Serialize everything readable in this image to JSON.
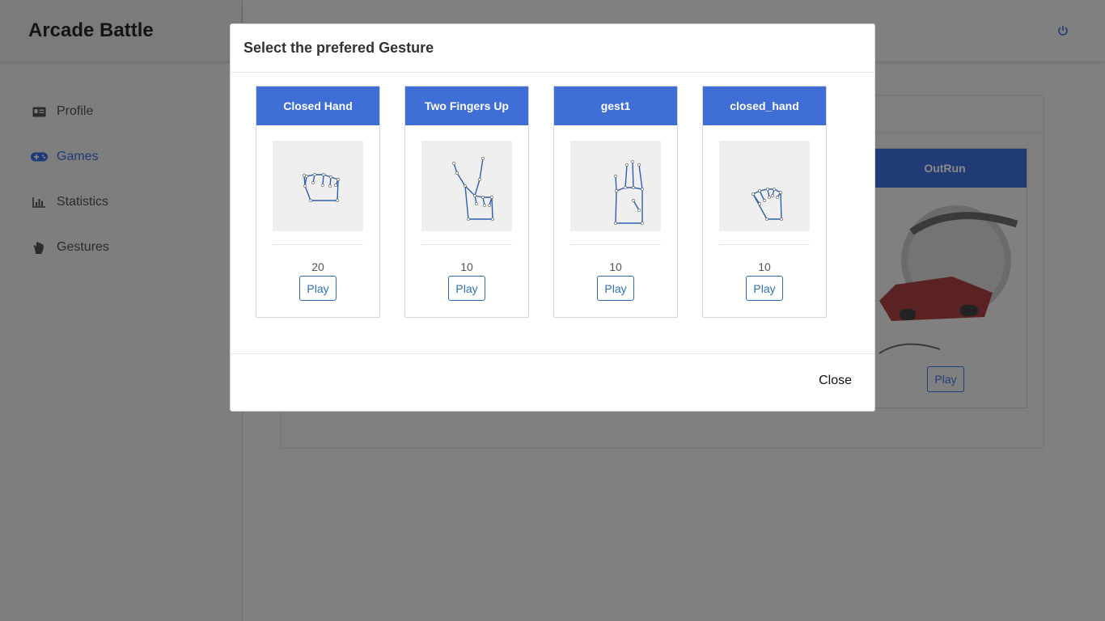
{
  "app": {
    "title": "Arcade Battle"
  },
  "sidebar": {
    "items": [
      {
        "label": "Profile",
        "icon": "id-card-icon",
        "active": false
      },
      {
        "label": "Games",
        "icon": "gamepad-icon",
        "active": true
      },
      {
        "label": "Statistics",
        "icon": "bar-chart-icon",
        "active": false
      },
      {
        "label": "Gestures",
        "icon": "hand-icon",
        "active": false
      }
    ]
  },
  "topbar": {
    "icon": "power-icon"
  },
  "background_game": {
    "title": "OutRun",
    "play_label": "Play"
  },
  "modal": {
    "title": "Select the prefered Gesture",
    "close_label": "Close",
    "gestures": [
      {
        "name": "Closed Hand",
        "count": "20",
        "play_label": "Play"
      },
      {
        "name": "Two Fingers Up",
        "count": "10",
        "play_label": "Play"
      },
      {
        "name": "gest1",
        "count": "10",
        "play_label": "Play"
      },
      {
        "name": "closed_hand",
        "count": "10",
        "play_label": "Play"
      }
    ]
  },
  "colors": {
    "accent": "#3f6fd6",
    "button_border": "#2f6fb5",
    "overlay": "#808080"
  }
}
